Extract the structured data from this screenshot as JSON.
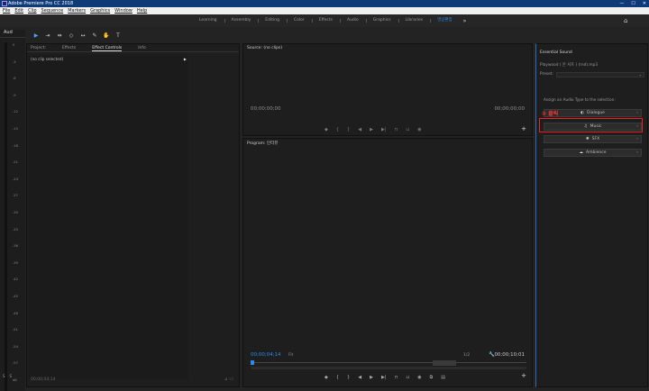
{
  "window": {
    "title": "Adobe Premiere Pro CC 2018",
    "controls": [
      "—",
      "☐",
      "✕"
    ]
  },
  "menu": [
    "File",
    "Edit",
    "Clip",
    "Sequence",
    "Markers",
    "Graphics",
    "Window",
    "Help"
  ],
  "workspaces": {
    "tabs": [
      "Learning",
      "Assembly",
      "Editing",
      "Color",
      "Effects",
      "Audio",
      "Graphics",
      "Libraries",
      "영상편집"
    ],
    "active": "영상편집",
    "more": "»"
  },
  "left_strip": {
    "header": "Aud",
    "scale": [
      "0",
      "-3",
      "-6",
      "-9",
      "-12",
      "-15",
      "-18",
      "-21",
      "-24",
      "-27",
      "-30",
      "-33",
      "-36",
      "-39",
      "-42",
      "-45",
      "-48",
      "-51",
      "-54",
      "-57",
      "dB"
    ],
    "footer_labels": [
      "S",
      "S"
    ]
  },
  "effect_controls": {
    "tabs": [
      "Project:",
      "Effects",
      "Effect Controls",
      "Info"
    ],
    "active_tab": "Effect Controls",
    "no_clip": "(no clip selected)",
    "timecode": "00;00;04;14"
  },
  "source_monitor": {
    "title": "Source: (no clips)",
    "timecode_left": "00;00;00;00",
    "timecode_right": "00;00;00;00"
  },
  "program_monitor": {
    "title": "Program: 인터뷰",
    "timecode_left": "00;00;04;14",
    "fit_label": "Fit",
    "ratio_label": "1/2",
    "timecode_right": "00;00;10;01"
  },
  "essential_sound": {
    "title": "Essential Sound",
    "file_label": "Playwood (  온 서프 ) (rnd).mp3",
    "preset_label": "Preset:",
    "assign_text": "Assign an Audio Type to the selection:",
    "buttons": [
      {
        "label": "Dialogue",
        "icon": "dialogue-icon"
      },
      {
        "label": "Music",
        "icon": "music-note-icon"
      },
      {
        "label": "SFX",
        "icon": "sfx-icon"
      },
      {
        "label": "Ambience",
        "icon": "ambience-icon"
      }
    ],
    "annotation": "② 클릭"
  }
}
